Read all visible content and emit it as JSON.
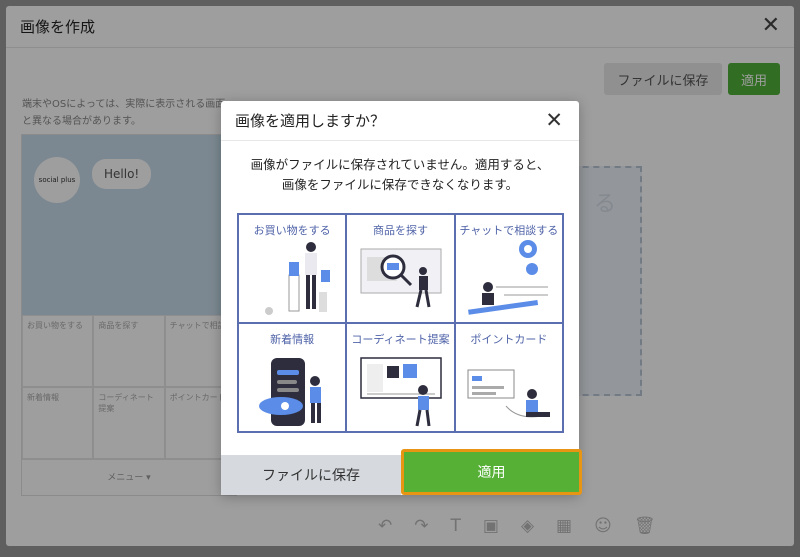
{
  "outer": {
    "title": "画像を作成",
    "save_label": "ファイルに保存",
    "apply_label": "適用",
    "note_line1": "端末やOSによっては、実際に表示される画面",
    "note_line2": "と異なる場合があります。"
  },
  "preview": {
    "logo": "social plus",
    "hello": "Hello!",
    "tiles": [
      "お買い物をする",
      "商品を探す",
      "チャットで相談",
      "新着情報",
      "コーディネート提案",
      "ポイントカード"
    ],
    "menu": "メニュー ▾"
  },
  "canvas": {
    "text": "る"
  },
  "toolbar_icons": [
    "undo-icon",
    "redo-icon",
    "text-icon",
    "image-icon",
    "fill-icon",
    "grid-icon",
    "emoji-icon",
    "trash-icon"
  ],
  "modal": {
    "title": "画像を適用しますか？",
    "message_line1": "画像がファイルに保存されていません。適用すると、",
    "message_line2": "画像をファイルに保存できなくなります。",
    "tiles": [
      {
        "label": "お買い物をする"
      },
      {
        "label": "商品を探す"
      },
      {
        "label": "チャットで相談する"
      },
      {
        "label": "新着情報"
      },
      {
        "label": "コーディネート提案"
      },
      {
        "label": "ポイントカード"
      }
    ],
    "save_button": "ファイルに保存",
    "apply_button": "適用"
  },
  "colors": {
    "accent": "#55b035",
    "highlight_border": "#e89513",
    "tile_border": "#5b6fb0"
  }
}
